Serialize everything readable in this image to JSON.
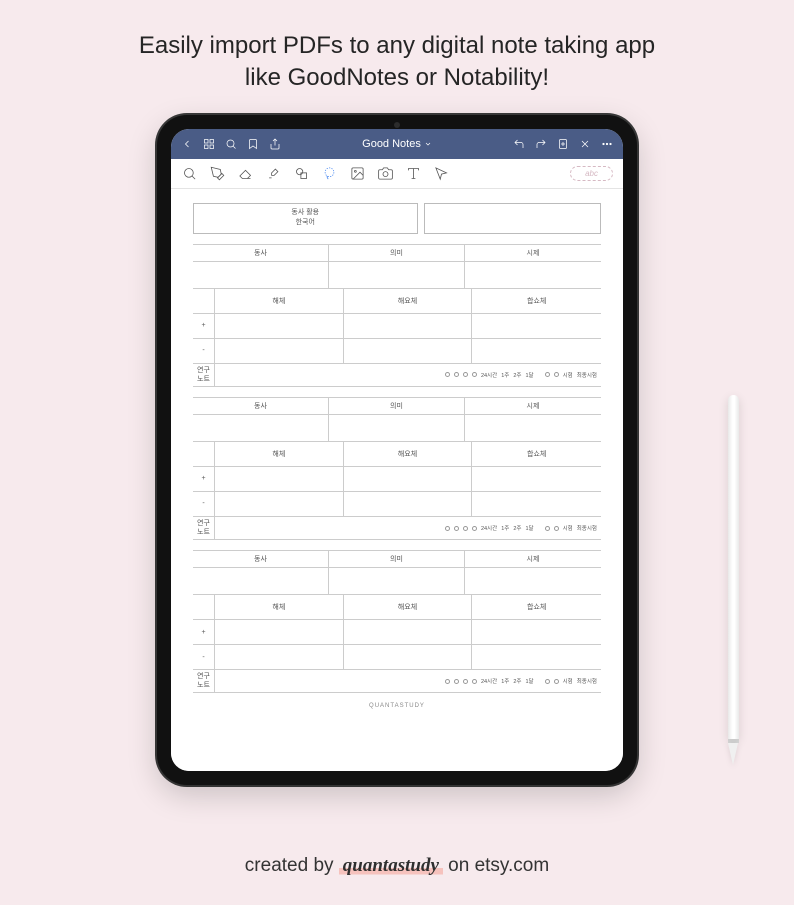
{
  "headline": {
    "line1": "Easily import PDFs to any digital note taking app",
    "line2": "like GoodNotes or Notability!"
  },
  "app": {
    "title": "Good Notes",
    "lasso_hint": "abc"
  },
  "worksheet": {
    "title_line1": "동사 활용",
    "title_line2": "한국어",
    "col_verb": "동사",
    "col_meaning": "의미",
    "col_tense": "시제",
    "form1": "해체",
    "form2": "해요체",
    "form3": "합쇼체",
    "plus": "+",
    "minus": "-",
    "study_label_1": "연구",
    "study_label_2": "노트",
    "intervals": [
      "24시간",
      "1주",
      "2주",
      "1달"
    ],
    "right_intervals": [
      "시험",
      "최종시험"
    ],
    "footer": "QUANTASTUDY"
  },
  "credit": {
    "prefix": "created by ",
    "brand": "quantastudy",
    "suffix": " on etsy.com"
  }
}
